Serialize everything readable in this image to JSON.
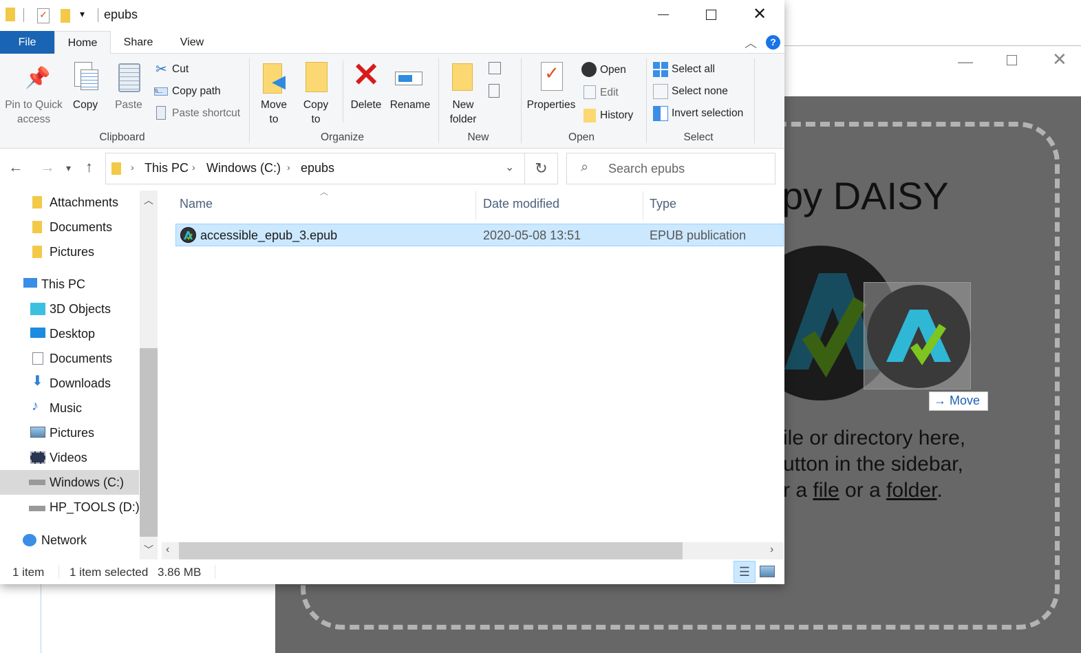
{
  "background_app": {
    "title_fragment": "py DAISY",
    "lines": [
      "ile or directory here,",
      "utton in the sidebar,"
    ],
    "line3_prefix": "r a ",
    "line3_file": "file",
    "line3_mid": " or a ",
    "line3_folder": "folder",
    "line3_suffix": ".",
    "drag_tooltip": "Move",
    "drag_arrow": "→"
  },
  "explorer": {
    "title": "epubs",
    "tabs": [
      {
        "label": "File"
      },
      {
        "label": "Home"
      },
      {
        "label": "Share"
      },
      {
        "label": "View"
      }
    ],
    "ribbon": {
      "pin": "Pin to Quick access",
      "copy": "Copy",
      "paste": "Paste",
      "cut": "Cut",
      "copy_path": "Copy path",
      "paste_shortcut": "Paste shortcut",
      "move_to": "Move to",
      "copy_to": "Copy to",
      "delete": "Delete",
      "rename": "Rename",
      "new_folder": "New folder",
      "properties": "Properties",
      "open": "Open",
      "edit": "Edit",
      "history": "History",
      "select_all": "Select all",
      "select_none": "Select none",
      "invert_selection": "Invert selection",
      "groups": [
        "Clipboard",
        "Organize",
        "New",
        "Open",
        "Select"
      ]
    },
    "address": {
      "crumbs": [
        "This PC",
        "Windows (C:)",
        "epubs"
      ]
    },
    "search": {
      "placeholder": "Search epubs"
    },
    "sidebar": [
      {
        "label": "Attachments",
        "icon": "folder-icon"
      },
      {
        "label": "Documents",
        "icon": "folder-icon"
      },
      {
        "label": "Pictures",
        "icon": "folder-icon"
      },
      {
        "label": "This PC",
        "icon": "computer-icon"
      },
      {
        "label": "3D Objects",
        "icon": "cube-icon"
      },
      {
        "label": "Desktop",
        "icon": "desktop-icon"
      },
      {
        "label": "Documents",
        "icon": "document-icon"
      },
      {
        "label": "Downloads",
        "icon": "download-icon"
      },
      {
        "label": "Music",
        "icon": "music-icon"
      },
      {
        "label": "Pictures",
        "icon": "pictures-icon"
      },
      {
        "label": "Videos",
        "icon": "video-icon"
      },
      {
        "label": "Windows (C:)",
        "icon": "drive-icon",
        "selected": true
      },
      {
        "label": "HP_TOOLS (D:)",
        "icon": "drive-icon"
      },
      {
        "label": "Network",
        "icon": "network-icon"
      }
    ],
    "columns": [
      "Name",
      "Date modified",
      "Type"
    ],
    "files": [
      {
        "name": "accessible_epub_3.epub",
        "modified": "2020-05-08 13:51",
        "type": "EPUB publication",
        "selected": true
      }
    ],
    "status": {
      "count": "1 item",
      "selected": "1 item selected",
      "size": "3.86 MB"
    },
    "colors": {
      "file_tab": "#1a64b4",
      "selection": "#cce8ff",
      "background_app": "#676767"
    }
  }
}
